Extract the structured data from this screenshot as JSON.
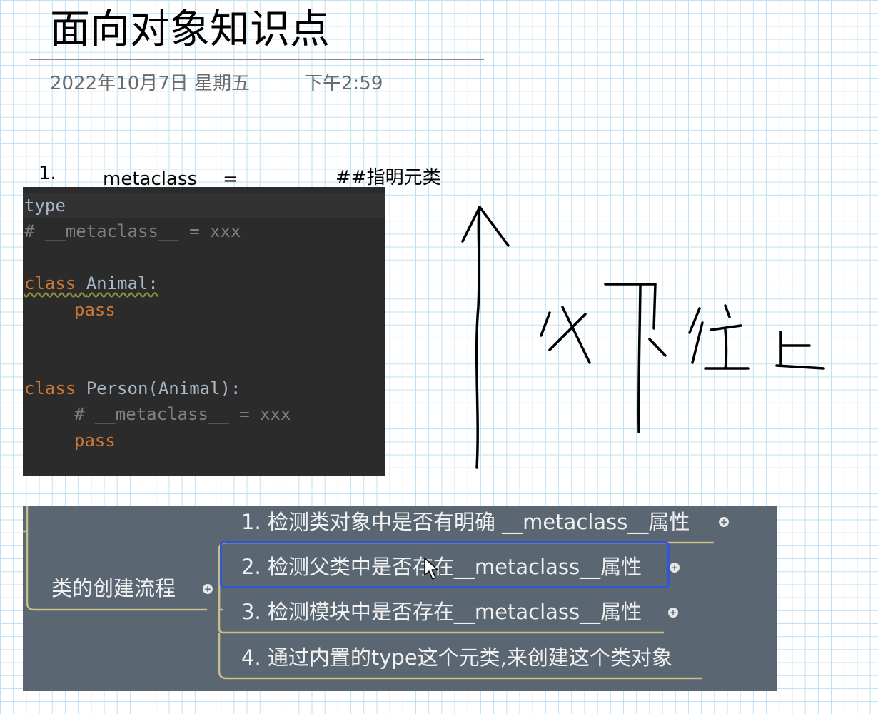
{
  "page": {
    "title": "面向对象知识点",
    "date": "2022年10月7日 星期五",
    "time": "下午2:59"
  },
  "note": {
    "number": "1.",
    "keyword": "metaclass",
    "equals": "=",
    "comment": "##指明元类"
  },
  "code": {
    "lines": [
      "type",
      "# __metaclass__ = xxx",
      "class Animal:",
      "pass",
      "class Person(Animal):",
      "# __metaclass__ = xxx",
      "pass"
    ],
    "tokens": {
      "l2_kw": "class",
      "l2_name": "Animal:",
      "l5_kw": "class",
      "l5_name": "Person(Animal):"
    }
  },
  "handwriting": {
    "arrow": "up-arrow",
    "text": "父下往上"
  },
  "mindmap": {
    "root": "类的创建流程",
    "items": [
      "1. 检测类对象中是否有明确 __metaclass__属性",
      "2. 检测父类中是否存在__metaclass__属性",
      "3. 检测模块中是否存在__metaclass__属性",
      "4. 通过内置的type这个元类,来创建这个类对象"
    ],
    "selected_index": 1
  },
  "colors": {
    "grid": "#bfe0f4",
    "code_bg": "#2b2b2b",
    "keyword": "#cc7832",
    "comment": "#808080",
    "mindmap_bg": "#5b6673",
    "branch": "#c8c08a",
    "selection": "#2f57d8"
  }
}
